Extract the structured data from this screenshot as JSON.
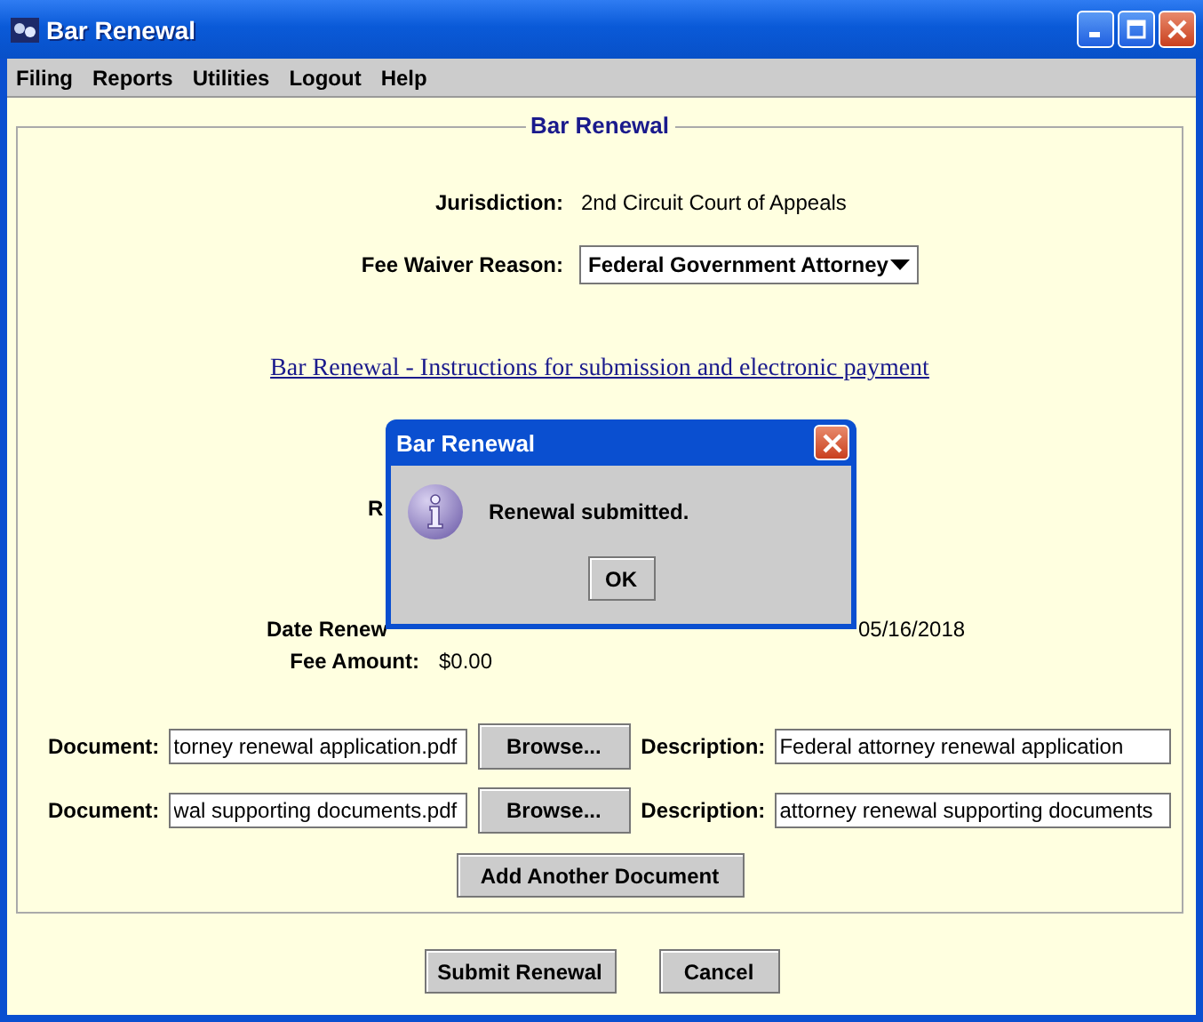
{
  "window": {
    "title": "Bar Renewal"
  },
  "menu": [
    "Filing",
    "Reports",
    "Utilities",
    "Logout",
    "Help"
  ],
  "panel": {
    "title": "Bar Renewal",
    "jurisdiction": {
      "label": "Jurisdiction:",
      "value": "2nd Circuit Court of Appeals"
    },
    "fee_waiver": {
      "label": "Fee Waiver Reason:",
      "value": "Federal Government Attorney"
    },
    "instructions_link": "Bar Renewal - Instructions for submission and electronic payment",
    "partial_label": "R",
    "date_renewed": {
      "label": "Date Renew",
      "projected_date": "05/16/2018"
    },
    "fee_amount": {
      "label": "Fee Amount:",
      "value": "$0.00"
    },
    "documents": [
      {
        "label": "Document:",
        "file": "torney renewal application.pdf",
        "browse": "Browse...",
        "description_label": "Description:",
        "description": "Federal attorney renewal application"
      },
      {
        "label": "Document:",
        "file": "wal supporting documents.pdf",
        "browse": "Browse...",
        "description_label": "Description:",
        "description": "attorney renewal supporting documents"
      }
    ],
    "add_document": "Add Another Document"
  },
  "buttons": [
    "Submit Renewal",
    "Cancel"
  ],
  "dialog": {
    "title": "Bar Renewal",
    "message": "Renewal submitted.",
    "button": "OK"
  }
}
